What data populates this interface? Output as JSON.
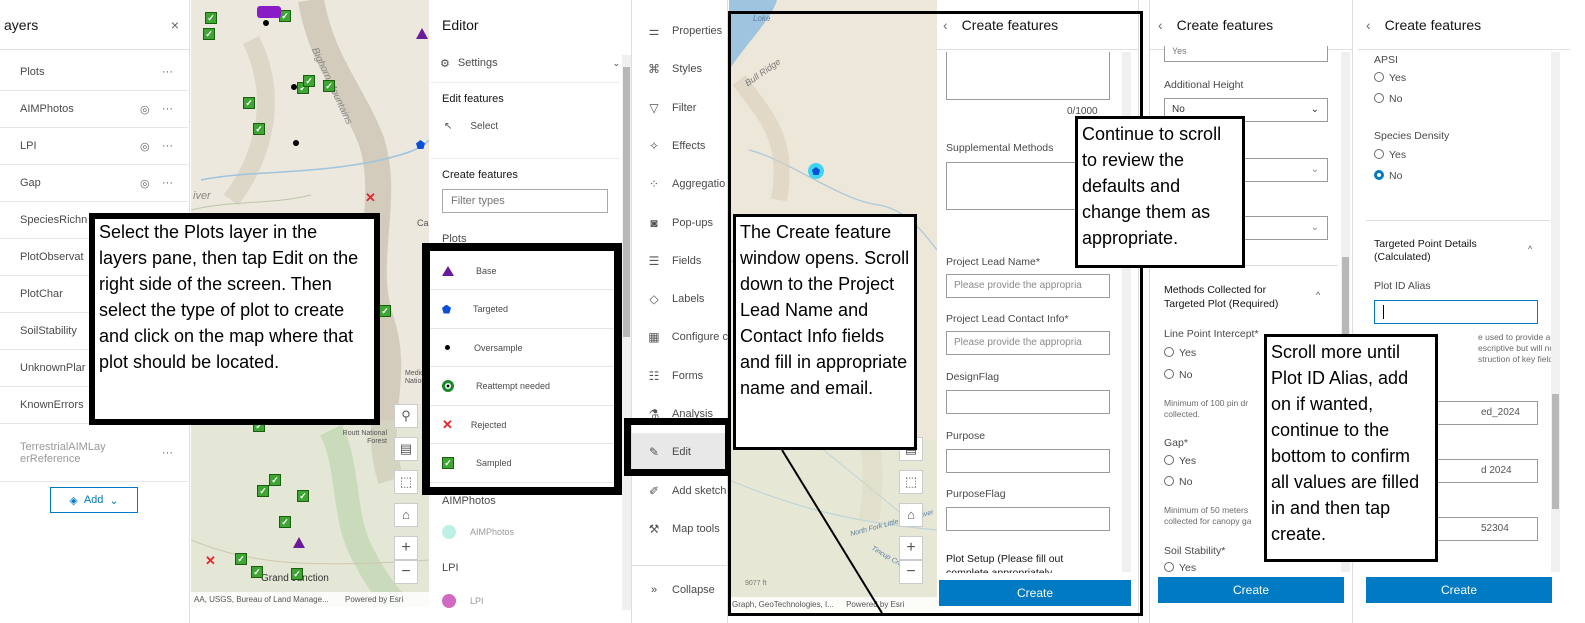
{
  "layers": {
    "title": "ayers",
    "close": "×",
    "add_label": "Add",
    "items": [
      {
        "name": "Plots",
        "eye": false
      },
      {
        "name": "AIMPhotos",
        "eye": true
      },
      {
        "name": "LPI",
        "eye": true
      },
      {
        "name": "Gap",
        "eye": true
      },
      {
        "name": "SpeciesRichn",
        "eye": false
      },
      {
        "name": "PlotObservat",
        "eye": false
      },
      {
        "name": "PlotChar",
        "eye": false
      },
      {
        "name": "SoilStability",
        "eye": false
      },
      {
        "name": "UnknownPlar",
        "eye": false
      },
      {
        "name": "KnownErrors",
        "eye": false
      },
      {
        "name": "TerrestrialAIMLay erReference",
        "eye": false
      }
    ],
    "more": "···"
  },
  "map1": {
    "labels": {
      "bighorn": "Bighorn Mountains",
      "river": "iver",
      "ca": "Ca",
      "medic": "Medic National",
      "routt": "Routt National Forest",
      "grand": "Grand Junction"
    },
    "attribution": "AA, USGS, Bureau of Land Manage...",
    "powered": "Powered by Esri"
  },
  "editor": {
    "title": "Editor",
    "settings": "Settings",
    "edit_features": "Edit features",
    "select": "Select",
    "create_features": "Create features",
    "filter_placeholder": "Filter types",
    "plots_heading": "Plots",
    "types": [
      {
        "label": "Base"
      },
      {
        "label": "Targeted"
      },
      {
        "label": "Oversample"
      },
      {
        "label": "Reattempt needed"
      },
      {
        "label": "Rejected"
      },
      {
        "label": "Sampled"
      }
    ],
    "aimphotos_heading": "AIMPhotos",
    "aimphotos_item": "AIMPhotos",
    "lpi_heading": "LPI",
    "lpi_item": "LPI"
  },
  "toolbar": {
    "items": [
      "Properties",
      "Styles",
      "Filter",
      "Effects",
      "Aggregatio",
      "Pop-ups",
      "Fields",
      "Labels",
      "Configure c",
      "Forms",
      "Analysis",
      "Edit",
      "Add sketch",
      "Map tools"
    ],
    "collapse": "Collapse"
  },
  "map2": {
    "labels": {
      "loke": "Loke",
      "bull": "Bull Ridge",
      "creek": "North Fork Little Wind River",
      "tincup": "Tincup Creek",
      "elev": "9077 ft"
    },
    "attribution": "Graph, GeoTechnologies, I...",
    "powered": "Powered by Esri"
  },
  "form1": {
    "title": "Create features",
    "counter1": "0/1000",
    "supplemental": "Supplemental Methods",
    "counter2": "0/",
    "lead_name": "Project Lead Name*",
    "lead_name_ph": "Please provide the appropria",
    "lead_contact": "Project Lead Contact Info*",
    "lead_contact_ph": "Please provide the appropria",
    "design_flag": "DesignFlag",
    "purpose": "Purpose",
    "purpose_flag": "PurposeFlag",
    "plot_setup": "Plot Setup (Please fill out",
    "plot_setup2": "complete appropriately",
    "create": "Create"
  },
  "form2": {
    "title": "Create features",
    "yes_top": "Yes",
    "add_height": "Additional Height",
    "no": "No",
    "methods": "Methods Collected for",
    "methods2": "Targeted Plot (Required)",
    "lpi": "Line Point Intercept*",
    "yes": "Yes",
    "no2": "No",
    "min100": "Minimum of 100 pin dr",
    "collected": "collected.",
    "gap": "Gap*",
    "yes2": "Yes",
    "no3": "No",
    "min50": "Minimum of 50 meters",
    "canopy": "collected for canopy ga",
    "soil": "Soil Stability*",
    "yes3": "Yes",
    "create": "Create"
  },
  "form3": {
    "title": "Create features",
    "apsi": "APSI",
    "yes": "Yes",
    "no": "No",
    "species_density": "Species Density",
    "yes2": "Yes",
    "no2": "No",
    "targeted": "Targeted Point Details",
    "calculated": "(Calculated)",
    "plot_id": "Plot ID Alias",
    "help1": "e used to provide a",
    "help2": "escriptive but will not",
    "help3": "struction of key fields.",
    "val1": "ed_2024",
    "val2": "d 2024",
    "val3": "52304",
    "create": "Create"
  },
  "annotations": {
    "a1": "Select the Plots layer in the layers pane, then tap Edit on the right side of the screen. Then select the type of plot to create and click on the map where that plot should be located.",
    "a2": "The Create feature window opens. Scroll down to the Project Lead Name and Contact Info fields and fill in appropriate name and email.",
    "a3": "Continue to scroll to review the defaults and change them as appropriate.",
    "a4": "Scroll more until Plot ID Alias, add on if wanted, continue to the bottom to confirm all values are filled in and then tap create."
  }
}
